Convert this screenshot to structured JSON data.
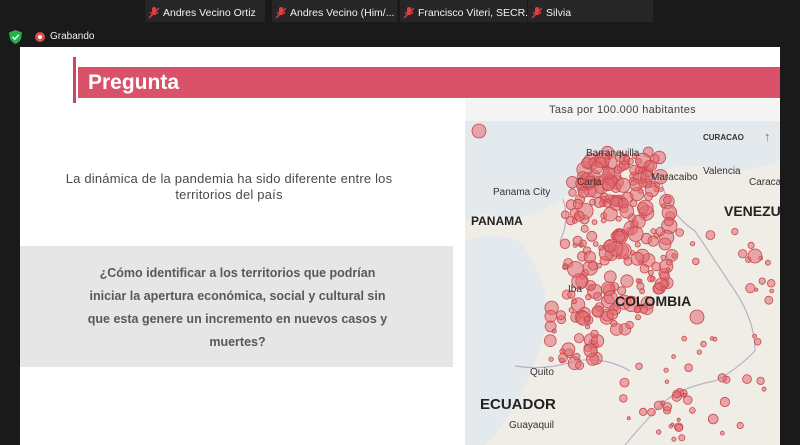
{
  "participants": [
    {
      "name": "Andres Vecino Ortiz"
    },
    {
      "name": "Andres Vecino (Him/..."
    },
    {
      "name": "Francisco Viteri, SECR..."
    },
    {
      "name": "Silvia"
    }
  ],
  "recording": {
    "label": "Grabando"
  },
  "slide": {
    "title": "Pregunta",
    "intro": "La dinámica de la pandemia ha sido diferente entre los territorios del país",
    "question": "¿Cómo identificar a los territorios que podrían iniciar la apertura económica, social y cultural sin que esta genere un incremento en nuevos casos y muertes?"
  },
  "map": {
    "title": "Tasa por 100.000 habitantes",
    "labels": {
      "curacao": "CURACAO",
      "barranquilla": "Barranquilla",
      "maracaibo": "Maracaibo",
      "valencia": "Valencia",
      "caracas": "Caracas",
      "panama_city": "Panama City",
      "cartagena": "Carta",
      "panama": "PANAMA",
      "venezuela": "VENEZU",
      "colombia": "COLOMBIA",
      "ibague": "Iba",
      "quito": "Quito",
      "ecuador": "ECUADOR",
      "guayaquil": "Guayaquil"
    },
    "bubble_color": "#e26a6f"
  },
  "colors": {
    "accent": "#d9526a",
    "question_bg": "#e6e6e6",
    "map_land": "#efede6"
  }
}
